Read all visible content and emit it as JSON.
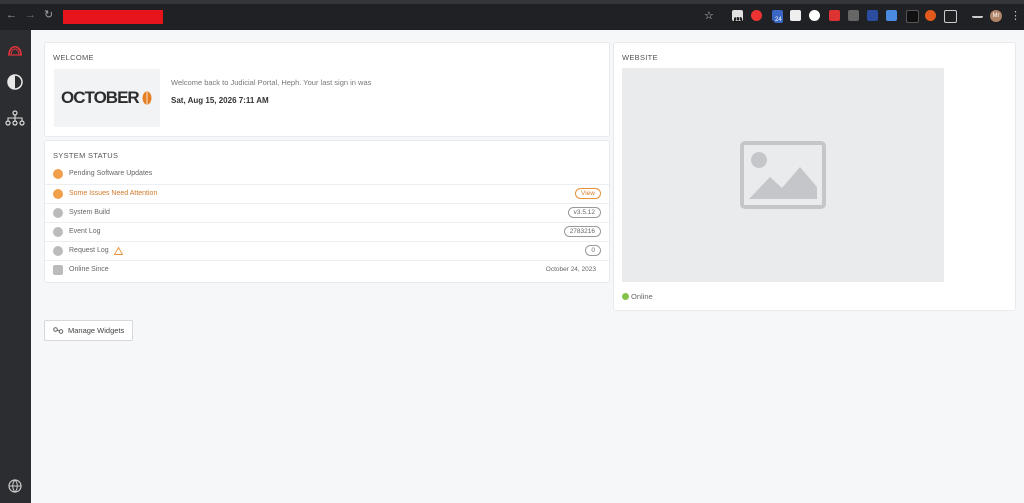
{
  "browser": {
    "back_icon": "arrow-left-icon",
    "forward_icon": "arrow-right-icon",
    "reload_icon": "reload-icon",
    "ext_badges": [
      "11",
      "24"
    ],
    "avatar_initials": "Mr"
  },
  "sidebar": {
    "items": [
      {
        "icon": "october-logo-icon"
      },
      {
        "icon": "contrast-icon"
      },
      {
        "icon": "sitemap-icon"
      },
      {
        "icon": "globe-icon"
      }
    ]
  },
  "welcome": {
    "title": "WELCOME",
    "logo_text": "OCTOBER",
    "message": "Welcome back to Judicial Portal, Heph. Your last sign in was",
    "last_signin": "Sat, Aug 15, 2026 7:11 AM"
  },
  "system_status": {
    "title": "SYSTEM STATUS",
    "rows": [
      {
        "label": "Pending Software Updates",
        "icon": "warning-circle-icon",
        "value": "",
        "style": "none"
      },
      {
        "label": "Some Issues Need Attention",
        "icon": "warning-circle-icon",
        "value": "View",
        "style": "orange"
      },
      {
        "label": "System Build",
        "icon": "info-circle-icon",
        "value": "v3.5.12",
        "style": "pill"
      },
      {
        "label": "Event Log",
        "icon": "warning-triangle-icon",
        "value": "2783216",
        "style": "pill"
      },
      {
        "label": "Request Log",
        "icon": "document-icon",
        "value": "0",
        "style": "pill"
      },
      {
        "label": "Online Since",
        "icon": "calendar-icon",
        "value": "October 24, 2023",
        "style": "plain"
      }
    ]
  },
  "manage_widgets_label": "Manage Widgets",
  "website": {
    "title": "WEBSITE",
    "status": "Online"
  },
  "colors": {
    "warning": "#f0a04b",
    "online": "#86c14b",
    "sidebar_bg": "#2b2d31"
  }
}
